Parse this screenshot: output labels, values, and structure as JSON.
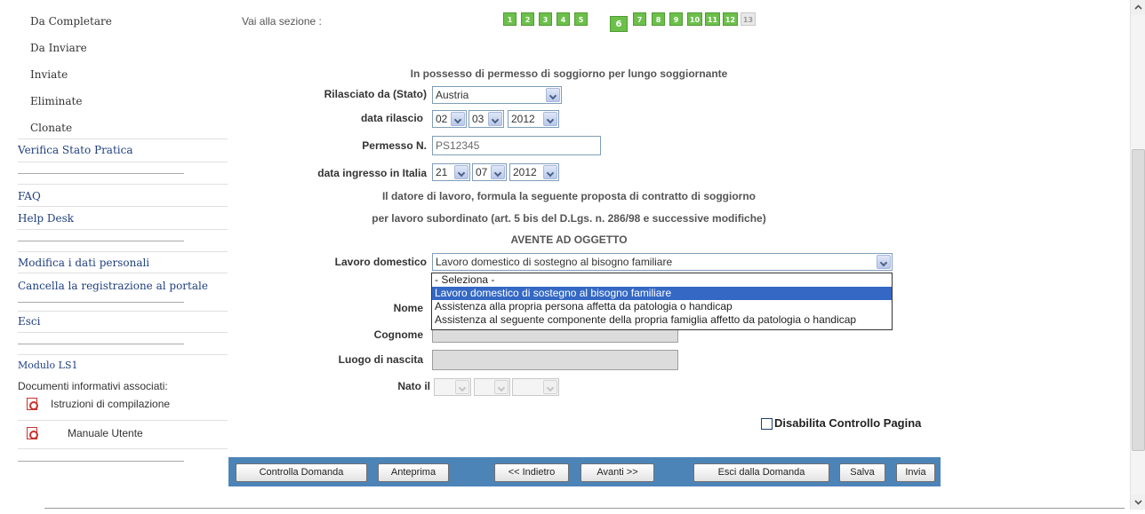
{
  "sidebar": {
    "submenu": [
      "Da Completare",
      "Da Inviare",
      "Inviate",
      "Eliminate",
      "Clonate"
    ],
    "verifica": "Verifica Stato Pratica",
    "faq": "FAQ",
    "helpdesk": "Help Desk",
    "modifica": "Modifica i dati personali",
    "cancella": "Cancella la registrazione al portale",
    "esci": "Esci",
    "modulo": "Modulo LS1",
    "doc_title": "Documenti informativi associati:",
    "doc1": "Istruzioni di compilazione",
    "doc2": "Manuale Utente"
  },
  "nav": {
    "label": "Vai alla sezione :",
    "pages": [
      "1",
      "2",
      "3",
      "4",
      "5",
      "6",
      "7",
      "8",
      "9",
      "10",
      "11",
      "12",
      "13"
    ],
    "current": "6",
    "disabled": "13"
  },
  "form": {
    "section_title": "In possesso di permesso di soggiorno per lungo soggiornante",
    "rilasciato_label": "Rilasciato da (Stato)",
    "rilasciato_value": "Austria",
    "data_rilascio_label": "data rilascio",
    "data_rilascio": {
      "day": "02",
      "month": "03",
      "year": "2012"
    },
    "permesso_label": "Permesso N.",
    "permesso_value": "PS12345",
    "ingresso_label": "data ingresso in Italia",
    "data_ingresso": {
      "day": "21",
      "month": "07",
      "year": "2012"
    },
    "proposta_line1": "Il datore di lavoro, formula la seguente proposta di contratto di soggiorno",
    "proposta_line2": "per lavoro subordinato (art. 5 bis del D.Lgs. n. 286/98 e successive modifiche)",
    "oggetto": "AVENTE AD OGGETTO",
    "lavoro_label": "Lavoro domestico",
    "lavoro_value": "Lavoro domestico di sostegno al bisogno familiare",
    "lavoro_options": [
      "- Seleziona -",
      "Lavoro domestico di sostegno al bisogno familiare",
      "Assistenza alla propria persona affetta da patologia o handicap",
      "Assistenza al seguente componente della propria famiglia affetto da patologia o handicap"
    ],
    "nome_label": "Nome",
    "cognome_label": "Cognome",
    "luogo_label": "Luogo di nascita",
    "nato_label": "Nato il",
    "disabilita_label": "Disabilita Controllo Pagina"
  },
  "buttons": {
    "controlla": "Controlla Domanda",
    "anteprima": "Anteprima",
    "indietro": "<< Indietro",
    "avanti": "Avanti >>",
    "esci_domanda": "Esci dalla Domanda",
    "salva": "Salva",
    "invia": "Invia"
  },
  "colors": {
    "page_active": "#6cc04a",
    "bar": "#4d84b8",
    "highlight": "#3468c4",
    "link": "#1f3f7f"
  }
}
